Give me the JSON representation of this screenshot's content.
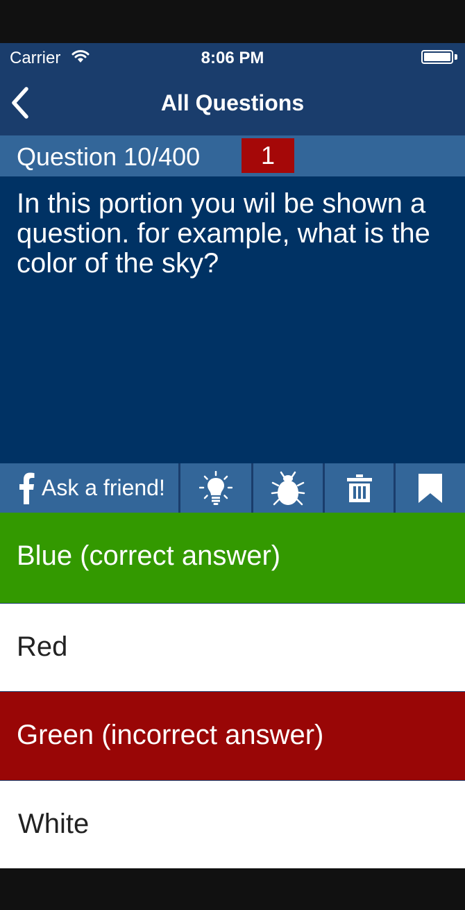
{
  "status_bar": {
    "carrier": "Carrier",
    "time": "8:06 PM"
  },
  "nav": {
    "back_icon": "chevron-left-icon",
    "title": "All Questions"
  },
  "question": {
    "counter": "Question 10/400",
    "badge": "1",
    "text": "In this portion you wil be shown a question. for example, what is the color of the sky?"
  },
  "toolbar": {
    "facebook_label": "Ask a friend!",
    "icons": [
      "facebook-icon",
      "lightbulb-icon",
      "bug-icon",
      "trash-icon",
      "bookmark-icon"
    ]
  },
  "answers": [
    {
      "label": "Blue (correct answer)",
      "state": "correct"
    },
    {
      "label": "Red",
      "state": "neutral"
    },
    {
      "label": "Green (incorrect answer)",
      "state": "incorrect"
    },
    {
      "label": "White",
      "state": "neutral"
    }
  ],
  "colors": {
    "nav_bar": "#1a3d6c",
    "question_header": "#336699",
    "question_body": "#003264",
    "badge": "#a50808",
    "correct": "#339900",
    "incorrect": "#990606"
  }
}
